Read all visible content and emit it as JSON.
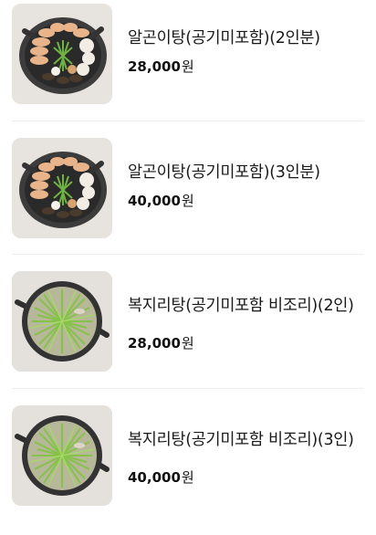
{
  "menu": {
    "items": [
      {
        "name": "알곤이탕(공기미포함)(2인분)",
        "price": "28,000",
        "currency": "원",
        "image_icon": "seafood-stew-image"
      },
      {
        "name": "알곤이탕(공기미포함)(3인분)",
        "price": "40,000",
        "currency": "원",
        "image_icon": "seafood-stew-image"
      },
      {
        "name": "복지리탕(공기미포함 비조리)(2인)",
        "price": "28,000",
        "currency": "원",
        "image_icon": "pufferfish-soup-image"
      },
      {
        "name": "복지리탕(공기미포함 비조리)(3인)",
        "price": "40,000",
        "currency": "원",
        "image_icon": "pufferfish-soup-image"
      }
    ]
  },
  "colors": {
    "background": "#ffffff",
    "text": "#1a1a1a",
    "divider": "#eeeeee"
  }
}
